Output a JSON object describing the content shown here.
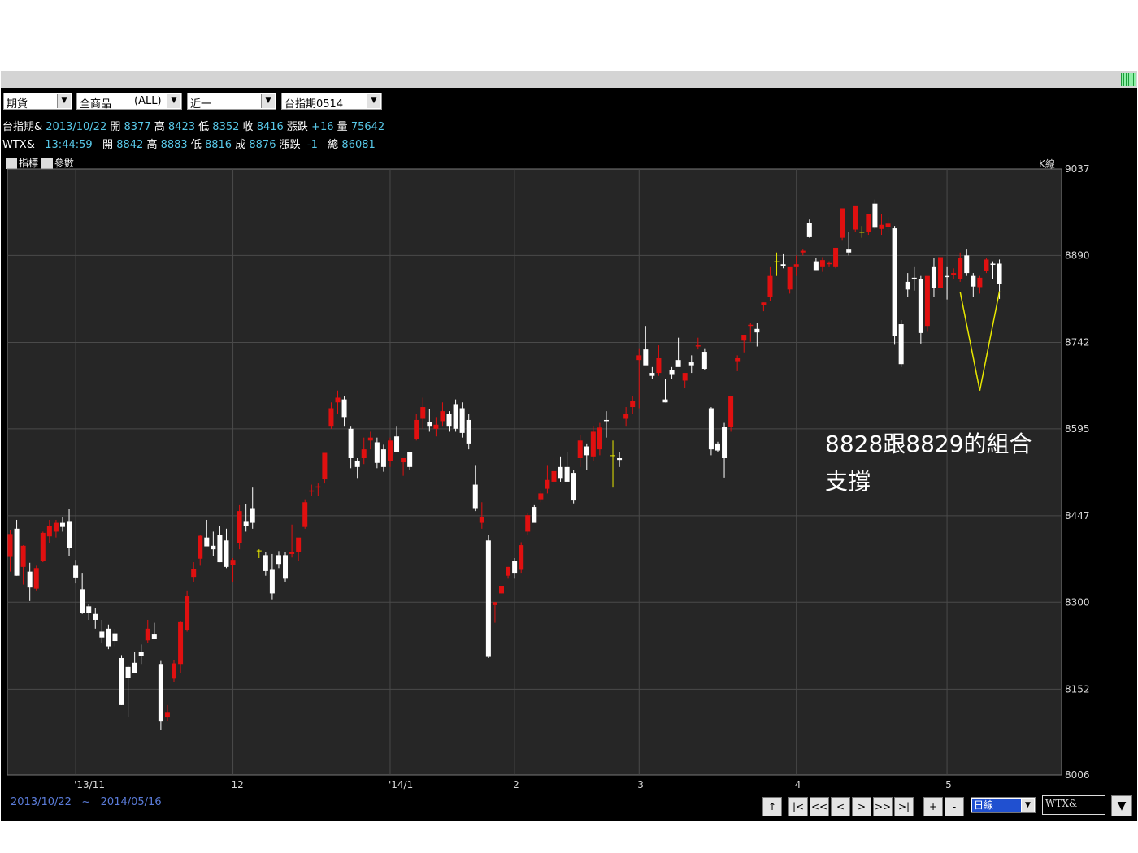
{
  "toolbar": {
    "market_select": "期貨",
    "product_select": "全商品",
    "product_select_code": "(ALL)",
    "range_select": "近一",
    "contract_select": "台指期0514"
  },
  "info_row1": {
    "symbol": "台指期&",
    "date": "2013/10/22",
    "open_label": "開",
    "open": "8377",
    "high_label": "高",
    "high": "8423",
    "low_label": "低",
    "low": "8352",
    "close_label": "收",
    "close": "8416",
    "change_label": "漲跌",
    "change": "+16",
    "volume_label": "量",
    "volume": "75642"
  },
  "info_row2": {
    "symbol": "WTX&",
    "time": "13:44:59",
    "open_label": "開",
    "open": "8842",
    "high_label": "高",
    "high": "8883",
    "low_label": "低",
    "low": "8816",
    "trade_label": "成",
    "trade": "8876",
    "change_label": "漲跌",
    "change": "-1",
    "total_label": "總",
    "total": "86081"
  },
  "toggles": {
    "indicator": "指標",
    "params": "參數"
  },
  "range_text": {
    "from": "2013/10/22",
    "sep": "~",
    "to": "2014/05/16"
  },
  "nav": {
    "up": "↑",
    "first": "|<",
    "fast_back": "<<",
    "back": "<",
    "forward": ">",
    "fast_forward": ">>",
    "last": ">|",
    "zoom_in": "+",
    "zoom_out": "-",
    "dropdown": "▼"
  },
  "period_select": "日線",
  "symbol_input": "WTX&",
  "colors": {
    "up": "#e01010",
    "down": "#ffffff",
    "background": "#262626",
    "grid": "#4a4a4a",
    "axis_text": "#d8d8d8",
    "annotation": "#e8e800"
  },
  "chart_data": {
    "type": "candlestick",
    "title": "",
    "panel_label": "K線",
    "ylim": [
      8006,
      9037
    ],
    "yticks": [
      9037,
      8890,
      8742,
      8595,
      8447,
      8300,
      8152,
      8006
    ],
    "xtick_labels": [
      "'13/11",
      "12",
      "'14/1",
      "2",
      "3",
      "4",
      "5"
    ],
    "xtick_index": [
      10,
      34,
      58,
      77,
      96,
      120,
      143
    ],
    "candles": [
      {
        "o": 8377,
        "h": 8423,
        "l": 8352,
        "c": 8416
      },
      {
        "o": 8425,
        "h": 8440,
        "l": 8345,
        "c": 8345
      },
      {
        "o": 8360,
        "h": 8397,
        "l": 8330,
        "c": 8396
      },
      {
        "o": 8352,
        "h": 8367,
        "l": 8302,
        "c": 8325
      },
      {
        "o": 8323,
        "h": 8362,
        "l": 8320,
        "c": 8358
      },
      {
        "o": 8370,
        "h": 8420,
        "l": 8368,
        "c": 8418
      },
      {
        "o": 8412,
        "h": 8440,
        "l": 8400,
        "c": 8430
      },
      {
        "o": 8420,
        "h": 8440,
        "l": 8410,
        "c": 8435
      },
      {
        "o": 8435,
        "h": 8445,
        "l": 8420,
        "c": 8428
      },
      {
        "o": 8438,
        "h": 8458,
        "l": 8378,
        "c": 8392
      },
      {
        "o": 8362,
        "h": 8372,
        "l": 8332,
        "c": 8342
      },
      {
        "o": 8322,
        "h": 8350,
        "l": 8280,
        "c": 8282
      },
      {
        "o": 8293,
        "h": 8297,
        "l": 8270,
        "c": 8282
      },
      {
        "o": 8280,
        "h": 8290,
        "l": 8255,
        "c": 8270
      },
      {
        "o": 8250,
        "h": 8270,
        "l": 8230,
        "c": 8240
      },
      {
        "o": 8255,
        "h": 8262,
        "l": 8220,
        "c": 8225
      },
      {
        "o": 8247,
        "h": 8255,
        "l": 8225,
        "c": 8234
      },
      {
        "o": 8205,
        "h": 8210,
        "l": 8125,
        "c": 8125
      },
      {
        "o": 8190,
        "h": 8192,
        "l": 8105,
        "c": 8171
      },
      {
        "o": 8197,
        "h": 8215,
        "l": 8180,
        "c": 8180
      },
      {
        "o": 8215,
        "h": 8228,
        "l": 8195,
        "c": 8208
      },
      {
        "o": 8235,
        "h": 8270,
        "l": 8230,
        "c": 8255
      },
      {
        "o": 8245,
        "h": 8265,
        "l": 8237,
        "c": 8237
      },
      {
        "o": 8195,
        "h": 8200,
        "l": 8083,
        "c": 8097
      },
      {
        "o": 8104,
        "h": 8125,
        "l": 8098,
        "c": 8112
      },
      {
        "o": 8170,
        "h": 8202,
        "l": 8164,
        "c": 8196
      },
      {
        "o": 8195,
        "h": 8268,
        "l": 8180,
        "c": 8266
      },
      {
        "o": 8252,
        "h": 8320,
        "l": 8250,
        "c": 8310
      },
      {
        "o": 8343,
        "h": 8368,
        "l": 8335,
        "c": 8357
      },
      {
        "o": 8374,
        "h": 8415,
        "l": 8362,
        "c": 8413
      },
      {
        "o": 8410,
        "h": 8440,
        "l": 8400,
        "c": 8395
      },
      {
        "o": 8396,
        "h": 8420,
        "l": 8379,
        "c": 8390
      },
      {
        "o": 8415,
        "h": 8430,
        "l": 8368,
        "c": 8368
      },
      {
        "o": 8405,
        "h": 8425,
        "l": 8358,
        "c": 8360
      },
      {
        "o": 8363,
        "h": 8375,
        "l": 8335,
        "c": 8372
      },
      {
        "o": 8400,
        "h": 8465,
        "l": 8390,
        "c": 8455
      },
      {
        "o": 8438,
        "h": 8467,
        "l": 8420,
        "c": 8430
      },
      {
        "o": 8460,
        "h": 8495,
        "l": 8425,
        "c": 8435
      },
      {
        "o": 8388,
        "h": 8390,
        "l": 8375,
        "c": 8388
      },
      {
        "o": 8380,
        "h": 8385,
        "l": 8345,
        "c": 8353
      },
      {
        "o": 8355,
        "h": 8382,
        "l": 8305,
        "c": 8315
      },
      {
        "o": 8380,
        "h": 8387,
        "l": 8358,
        "c": 8365
      },
      {
        "o": 8380,
        "h": 8385,
        "l": 8335,
        "c": 8340
      },
      {
        "o": 8382,
        "h": 8432,
        "l": 8376,
        "c": 8385
      },
      {
        "o": 8385,
        "h": 8405,
        "l": 8370,
        "c": 8410
      },
      {
        "o": 8428,
        "h": 8475,
        "l": 8425,
        "c": 8470
      },
      {
        "o": 8488,
        "h": 8500,
        "l": 8480,
        "c": 8490
      },
      {
        "o": 8495,
        "h": 8502,
        "l": 8480,
        "c": 8497
      },
      {
        "o": 8509,
        "h": 8552,
        "l": 8502,
        "c": 8554
      },
      {
        "o": 8600,
        "h": 8640,
        "l": 8595,
        "c": 8630
      },
      {
        "o": 8640,
        "h": 8660,
        "l": 8620,
        "c": 8648
      },
      {
        "o": 8645,
        "h": 8650,
        "l": 8600,
        "c": 8615
      },
      {
        "o": 8595,
        "h": 8600,
        "l": 8528,
        "c": 8545
      },
      {
        "o": 8540,
        "h": 8545,
        "l": 8510,
        "c": 8530
      },
      {
        "o": 8545,
        "h": 8580,
        "l": 8535,
        "c": 8560
      },
      {
        "o": 8575,
        "h": 8590,
        "l": 8560,
        "c": 8580
      },
      {
        "o": 8572,
        "h": 8580,
        "l": 8528,
        "c": 8537
      },
      {
        "o": 8560,
        "h": 8568,
        "l": 8522,
        "c": 8530
      },
      {
        "o": 8540,
        "h": 8580,
        "l": 8530,
        "c": 8575
      },
      {
        "o": 8582,
        "h": 8600,
        "l": 8555,
        "c": 8555
      },
      {
        "o": 8538,
        "h": 8545,
        "l": 8515,
        "c": 8545
      },
      {
        "o": 8555,
        "h": 8555,
        "l": 8525,
        "c": 8530
      },
      {
        "o": 8578,
        "h": 8620,
        "l": 8575,
        "c": 8610
      },
      {
        "o": 8612,
        "h": 8648,
        "l": 8595,
        "c": 8632
      },
      {
        "o": 8607,
        "h": 8628,
        "l": 8590,
        "c": 8600
      },
      {
        "o": 8595,
        "h": 8615,
        "l": 8582,
        "c": 8602
      },
      {
        "o": 8608,
        "h": 8640,
        "l": 8600,
        "c": 8625
      },
      {
        "o": 8620,
        "h": 8625,
        "l": 8590,
        "c": 8600
      },
      {
        "o": 8637,
        "h": 8645,
        "l": 8590,
        "c": 8595
      },
      {
        "o": 8630,
        "h": 8640,
        "l": 8580,
        "c": 8588
      },
      {
        "o": 8610,
        "h": 8620,
        "l": 8560,
        "c": 8570
      },
      {
        "o": 8500,
        "h": 8532,
        "l": 8455,
        "c": 8460
      },
      {
        "o": 8435,
        "h": 8470,
        "l": 8425,
        "c": 8445
      },
      {
        "o": 8405,
        "h": 8415,
        "l": 8205,
        "c": 8207
      },
      {
        "o": 8295,
        "h": 8300,
        "l": 8265,
        "c": 8300
      },
      {
        "o": 8315,
        "h": 8325,
        "l": 8315,
        "c": 8328
      },
      {
        "o": 8345,
        "h": 8360,
        "l": 8340,
        "c": 8360
      },
      {
        "o": 8370,
        "h": 8375,
        "l": 8340,
        "c": 8350
      },
      {
        "o": 8355,
        "h": 8402,
        "l": 8350,
        "c": 8397
      },
      {
        "o": 8420,
        "h": 8452,
        "l": 8415,
        "c": 8448
      },
      {
        "o": 8462,
        "h": 8465,
        "l": 8440,
        "c": 8435
      },
      {
        "o": 8475,
        "h": 8490,
        "l": 8470,
        "c": 8485
      },
      {
        "o": 8493,
        "h": 8532,
        "l": 8485,
        "c": 8508
      },
      {
        "o": 8505,
        "h": 8545,
        "l": 8490,
        "c": 8523
      },
      {
        "o": 8530,
        "h": 8548,
        "l": 8505,
        "c": 8510
      },
      {
        "o": 8530,
        "h": 8555,
        "l": 8510,
        "c": 8505
      },
      {
        "o": 8520,
        "h": 8525,
        "l": 8468,
        "c": 8473
      },
      {
        "o": 8545,
        "h": 8585,
        "l": 8530,
        "c": 8575
      },
      {
        "o": 8565,
        "h": 8570,
        "l": 8525,
        "c": 8550
      },
      {
        "o": 8548,
        "h": 8600,
        "l": 8540,
        "c": 8590
      },
      {
        "o": 8560,
        "h": 8605,
        "l": 8550,
        "c": 8597
      },
      {
        "o": 8610,
        "h": 8625,
        "l": 8580,
        "c": 8608
      },
      {
        "o": 8550,
        "h": 8575,
        "l": 8495,
        "c": 8550
      },
      {
        "o": 8545,
        "h": 8555,
        "l": 8530,
        "c": 8542
      },
      {
        "o": 8612,
        "h": 8632,
        "l": 8600,
        "c": 8620
      },
      {
        "o": 8632,
        "h": 8650,
        "l": 8620,
        "c": 8642
      },
      {
        "o": 8712,
        "h": 8732,
        "l": 8630,
        "c": 8720
      },
      {
        "o": 8730,
        "h": 8770,
        "l": 8725,
        "c": 8703
      },
      {
        "o": 8690,
        "h": 8700,
        "l": 8680,
        "c": 8685
      },
      {
        "o": 8690,
        "h": 8737,
        "l": 8685,
        "c": 8715
      },
      {
        "o": 8645,
        "h": 8680,
        "l": 8640,
        "c": 8640
      },
      {
        "o": 8695,
        "h": 8700,
        "l": 8680,
        "c": 8688
      },
      {
        "o": 8712,
        "h": 8750,
        "l": 8708,
        "c": 8700
      },
      {
        "o": 8677,
        "h": 8688,
        "l": 8665,
        "c": 8690
      },
      {
        "o": 8708,
        "h": 8720,
        "l": 8690,
        "c": 8703
      },
      {
        "o": 8735,
        "h": 8750,
        "l": 8730,
        "c": 8737
      },
      {
        "o": 8726,
        "h": 8732,
        "l": 8695,
        "c": 8697
      },
      {
        "o": 8630,
        "h": 8632,
        "l": 8550,
        "c": 8560
      },
      {
        "o": 8570,
        "h": 8573,
        "l": 8555,
        "c": 8558
      },
      {
        "o": 8598,
        "h": 8605,
        "l": 8512,
        "c": 8545
      },
      {
        "o": 8598,
        "h": 8648,
        "l": 8590,
        "c": 8650
      },
      {
        "o": 8710,
        "h": 8720,
        "l": 8693,
        "c": 8715
      },
      {
        "o": 8745,
        "h": 8755,
        "l": 8725,
        "c": 8755
      },
      {
        "o": 8770,
        "h": 8775,
        "l": 8743,
        "c": 8772
      },
      {
        "o": 8765,
        "h": 8775,
        "l": 8735,
        "c": 8759
      },
      {
        "o": 8805,
        "h": 8810,
        "l": 8795,
        "c": 8810
      },
      {
        "o": 8820,
        "h": 8870,
        "l": 8812,
        "c": 8855
      },
      {
        "o": 8880,
        "h": 8895,
        "l": 8855,
        "c": 8880
      },
      {
        "o": 8875,
        "h": 8892,
        "l": 8868,
        "c": 8872
      },
      {
        "o": 8832,
        "h": 8865,
        "l": 8825,
        "c": 8870
      },
      {
        "o": 8870,
        "h": 8890,
        "l": 8855,
        "c": 8875
      },
      {
        "o": 8895,
        "h": 8900,
        "l": 8890,
        "c": 8898
      },
      {
        "o": 8945,
        "h": 8951,
        "l": 8920,
        "c": 8921
      },
      {
        "o": 8880,
        "h": 8885,
        "l": 8865,
        "c": 8865
      },
      {
        "o": 8870,
        "h": 8887,
        "l": 8862,
        "c": 8882
      },
      {
        "o": 8875,
        "h": 8880,
        "l": 8870,
        "c": 8877
      },
      {
        "o": 8870,
        "h": 8890,
        "l": 8868,
        "c": 8903
      },
      {
        "o": 8920,
        "h": 8935,
        "l": 8915,
        "c": 8970
      },
      {
        "o": 8900,
        "h": 8930,
        "l": 8890,
        "c": 8895
      },
      {
        "o": 8934,
        "h": 8960,
        "l": 8930,
        "c": 8975
      },
      {
        "o": 8930,
        "h": 8940,
        "l": 8920,
        "c": 8930
      },
      {
        "o": 8930,
        "h": 8945,
        "l": 8925,
        "c": 8960
      },
      {
        "o": 8978,
        "h": 8985,
        "l": 8935,
        "c": 8937
      },
      {
        "o": 8935,
        "h": 8960,
        "l": 8925,
        "c": 8942
      },
      {
        "o": 8938,
        "h": 8955,
        "l": 8930,
        "c": 8944
      },
      {
        "o": 8936,
        "h": 8940,
        "l": 8738,
        "c": 8753
      },
      {
        "o": 8773,
        "h": 8780,
        "l": 8700,
        "c": 8705
      },
      {
        "o": 8845,
        "h": 8860,
        "l": 8820,
        "c": 8832
      },
      {
        "o": 8852,
        "h": 8870,
        "l": 8830,
        "c": 8850
      },
      {
        "o": 8850,
        "h": 8855,
        "l": 8740,
        "c": 8758
      },
      {
        "o": 8770,
        "h": 8780,
        "l": 8760,
        "c": 8855
      },
      {
        "o": 8870,
        "h": 8885,
        "l": 8820,
        "c": 8835
      },
      {
        "o": 8835,
        "h": 8880,
        "l": 8835,
        "c": 8887
      },
      {
        "o": 8855,
        "h": 8870,
        "l": 8815,
        "c": 8853
      },
      {
        "o": 8856,
        "h": 8868,
        "l": 8850,
        "c": 8860
      },
      {
        "o": 8850,
        "h": 8895,
        "l": 8845,
        "c": 8885
      },
      {
        "o": 8890,
        "h": 8900,
        "l": 8855,
        "c": 8860
      },
      {
        "o": 8855,
        "h": 8860,
        "l": 8820,
        "c": 8837
      },
      {
        "o": 8836,
        "h": 8855,
        "l": 8825,
        "c": 8852
      },
      {
        "o": 8863,
        "h": 8885,
        "l": 8860,
        "c": 8883
      },
      {
        "o": 8876,
        "h": 8880,
        "l": 8850,
        "c": 8874
      },
      {
        "o": 8876,
        "h": 8883,
        "l": 8816,
        "c": 8842
      }
    ],
    "annotation_text_line1": "8828跟8829的組合",
    "annotation_text_line2": "支撐"
  }
}
